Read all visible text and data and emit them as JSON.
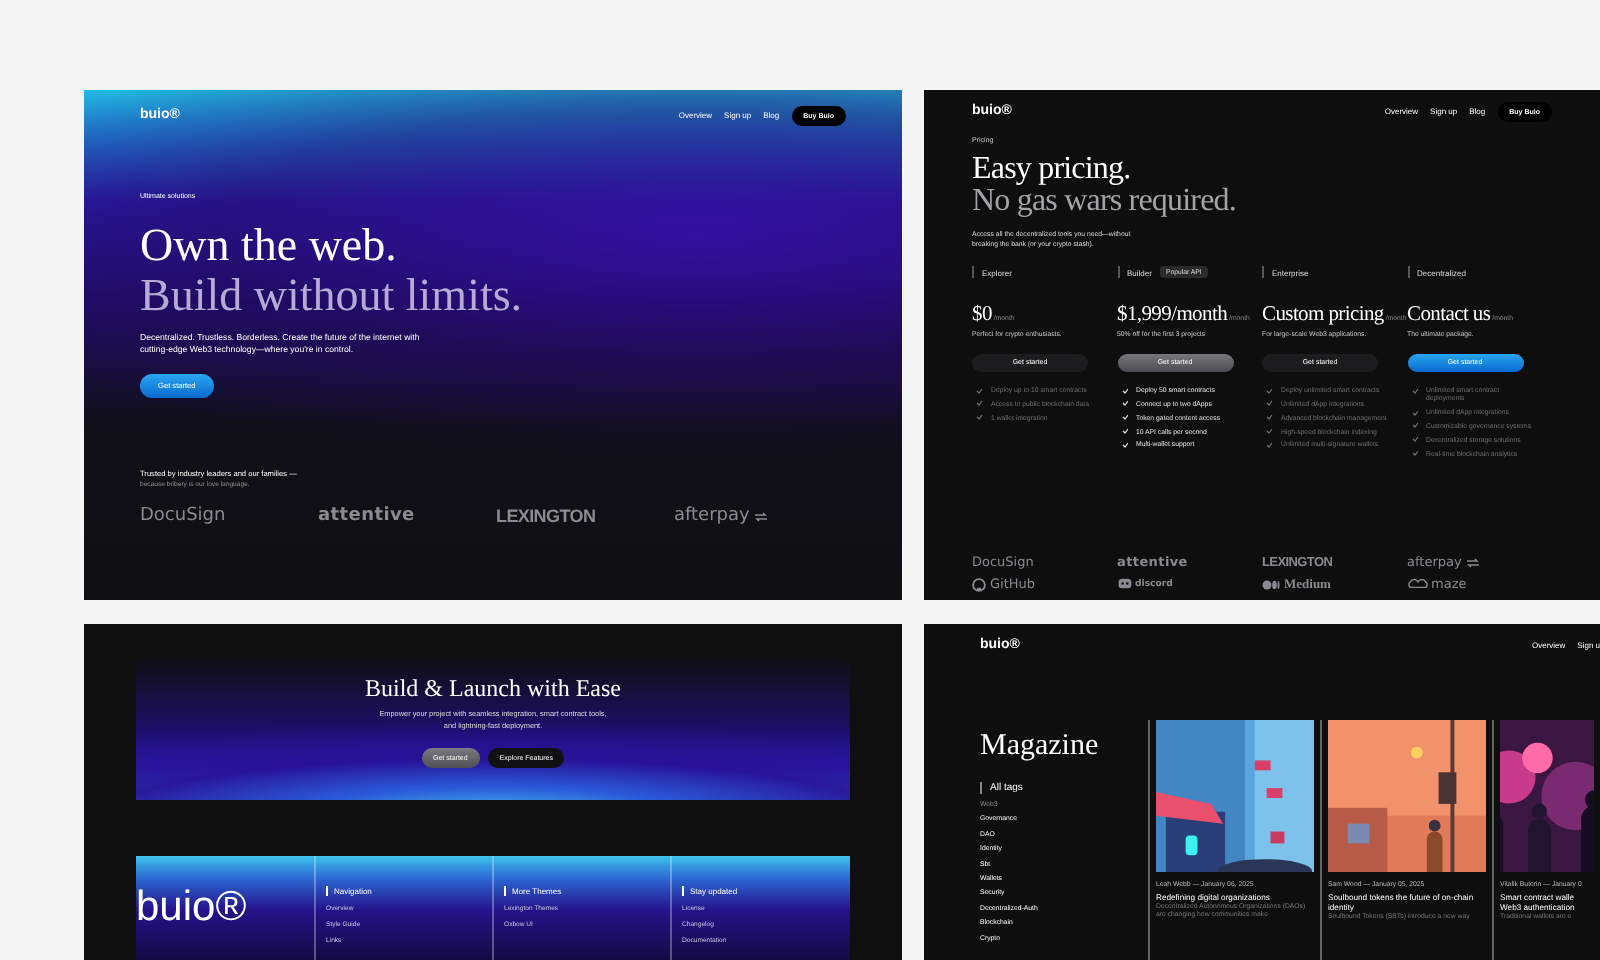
{
  "hero_page": {
    "nav": {
      "logo": "buio®",
      "links": [
        "Overview",
        "Sign up",
        "Blog"
      ],
      "button": "Buy Buio"
    },
    "eyebrow": "Ultimate solutions",
    "headline": [
      "Own the web.",
      "Build without limits."
    ],
    "description": "Decentralized. Trustless. Borderless. Create the future of the internet with cutting-edge Web3 technology—where you're in control.",
    "cta": "Get started",
    "trusted": "Trusted by industry leaders and our families —",
    "trusted_note": "because bribery is our love language.",
    "logos": [
      {
        "name": "DocuSign",
        "kind": "docusign"
      },
      {
        "name": "attentive",
        "kind": "attentive"
      },
      {
        "name": "LEXINGTON",
        "kind": "lexington"
      },
      {
        "name": "afterpay",
        "kind": "afterpay"
      }
    ]
  },
  "pricing_page": {
    "nav": {
      "logo": "buio®",
      "links": [
        "Overview",
        "Sign up",
        "Blog"
      ],
      "button": "Buy Buio"
    },
    "eyebrow": "Pricing",
    "headline": [
      "Easy pricing.",
      "No gas wars required."
    ],
    "description": "Access all the decentralized tools you need—without breaking the bank (or your crypto stash).",
    "plans": [
      {
        "name": "Explorer",
        "price": "$0",
        "period": "/month",
        "note": "Perfect for crypto enthusiasts.",
        "button": "Get started",
        "kind": "basic",
        "features": [
          "Deploy up to 10 smart contracts",
          "Access to public blockchain data",
          "1 wallet integration"
        ]
      },
      {
        "name": "Builder",
        "badge": "Popular API",
        "price": "$1,999/month",
        "period": "/month",
        "note": "50% off for the first 3 projects",
        "button": "Get started",
        "kind": "popular",
        "features": [
          "Deploy 50 smart contracts",
          "Connect up to two dApps",
          "Token gated content access",
          "10 API calls per second",
          "Multi-wallet support"
        ]
      },
      {
        "name": "Enterprise",
        "price": "Custom pricing",
        "period": "/month",
        "note": "For large-scale Web3 applications.",
        "button": "Get started",
        "kind": "basic",
        "features": [
          "Deploy unlimited smart contracts",
          "Unlimited dApp integrations",
          "Advanced blockchain management",
          "High-speed blockchain indexing",
          "Unlimited multi-signature wallets"
        ]
      },
      {
        "name": "Decentralized",
        "price": "Contact us",
        "period": "/month",
        "note": "The ultimate package.",
        "button": "Get started",
        "kind": "premium",
        "features": [
          "Unlimited smart contract deployments",
          "Unlimited dApp integrations",
          "Customizable governance systems",
          "Decentralized storage solutions",
          "Real-time blockchain analytics"
        ]
      }
    ],
    "logos": [
      {
        "name": "DocuSign",
        "kind": "docusign"
      },
      {
        "name": "attentive",
        "kind": "attentive"
      },
      {
        "name": "LEXINGTON",
        "kind": "lexington"
      },
      {
        "name": "afterpay",
        "kind": "afterpay"
      },
      {
        "name": "GitHub",
        "kind": "github"
      },
      {
        "name": "discord",
        "kind": "discord"
      },
      {
        "name": "Medium",
        "kind": "medium"
      },
      {
        "name": "maze",
        "kind": "maze"
      }
    ]
  },
  "launch_page": {
    "title": "Build & Launch with Ease",
    "description": "Empower your project with seamless integration, smart contract tools, and lightning-fast deployment.",
    "buttons": [
      {
        "label": "Get started",
        "kind": "primary"
      },
      {
        "label": "Explore Features",
        "kind": "secondary"
      }
    ],
    "footer": {
      "logo": "buio®",
      "columns": [
        {
          "heading": "Navigation",
          "links": [
            "Overview",
            "Style Guide",
            "Links"
          ]
        },
        {
          "heading": "More Themes",
          "links": [
            "Lexington Themes",
            "Oxbow UI"
          ]
        },
        {
          "heading": "Stay updated",
          "links": [
            "License",
            "Changelog",
            "Documentation"
          ]
        }
      ]
    }
  },
  "magazine_page": {
    "nav": {
      "logo": "buio®",
      "links": [
        "Overview",
        "Sign u"
      ]
    },
    "title": "Magazine",
    "tags_heading": "All tags",
    "tags": [
      {
        "label": "Web3",
        "selected": true
      },
      {
        "label": "Governance",
        "selected": false
      },
      {
        "label": "DAO",
        "selected": false
      },
      {
        "label": "Identity",
        "selected": false
      },
      {
        "label": "Sbt",
        "selected": false
      },
      {
        "label": "Wallets",
        "selected": false
      },
      {
        "label": "Security",
        "selected": false
      },
      {
        "label": "Decentralized-Auth",
        "selected": false
      },
      {
        "label": "Blockchain",
        "selected": false
      },
      {
        "label": "Crypto",
        "selected": false
      }
    ],
    "articles": [
      {
        "byline": "Leah Webb — January 06, 2025",
        "title": "Redefining digital organizations",
        "excerpt": "Decentralized Autonomous Organizations (DAOs) are changing how communities make"
      },
      {
        "byline": "Sam Wood — January 05, 2025",
        "title": "Soulbound tokens the future of on-chain identity",
        "excerpt": "Soulbound Tokens (SBTs) introduce a new way"
      },
      {
        "byline": "Vitalik Buterin — January 0",
        "title": "Smart contract walle\nWeb3 authentication",
        "excerpt": "Traditional wallets are e"
      }
    ]
  }
}
